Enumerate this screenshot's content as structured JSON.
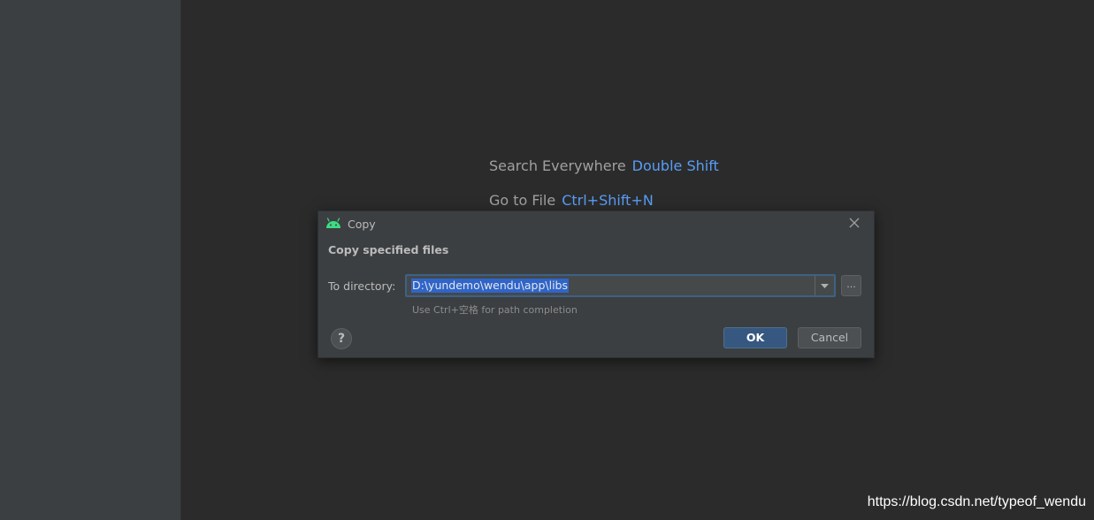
{
  "editor": {
    "hints": [
      {
        "label": "Search Everywhere",
        "shortcut": "Double Shift"
      },
      {
        "label": "Go to File",
        "shortcut": "Ctrl+Shift+N"
      }
    ]
  },
  "dialog": {
    "title": "Copy",
    "app_icon": "android-icon",
    "heading": "Copy specified files",
    "directory_label": "To directory:",
    "directory_value": "D:\\yundemo\\wendu\\app\\libs",
    "browse_label": "...",
    "path_hint": "Use Ctrl+空格 for path completion",
    "help_label": "?",
    "ok_label": "OK",
    "cancel_label": "Cancel"
  },
  "watermark": "https://blog.csdn.net/typeof_wendu",
  "colors": {
    "accent": "#589df6",
    "primary_button": "#365880",
    "selection": "#2f65ca",
    "focus_border": "#3d6185"
  }
}
